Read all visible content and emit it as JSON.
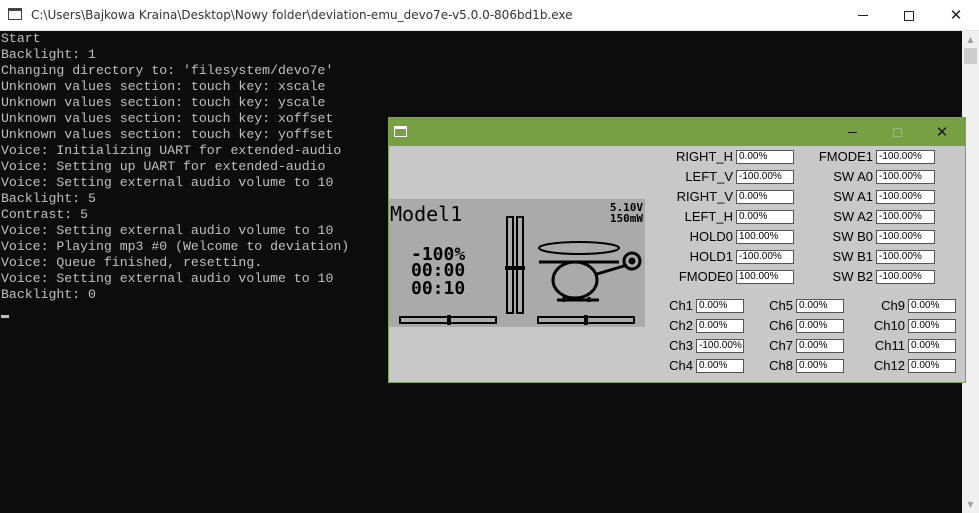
{
  "console_window": {
    "title": "C:\\Users\\Bajkowa Kraina\\Desktop\\Nowy folder\\deviation-emu_devo7e-v5.0.0-806bd1b.exe",
    "lines": [
      "Start",
      "Backlight: 1",
      "Changing directory to: 'filesystem/devo7e'",
      "Unknown values section: touch key: xscale",
      "Unknown values section: touch key: yscale",
      "Unknown values section: touch key: xoffset",
      "Unknown values section: touch key: yoffset",
      "Voice: Initializing UART for extended-audio",
      "Voice: Setting up UART for extended-audio",
      "Voice: Setting external audio volume to 10",
      "Backlight: 5",
      "Contrast: 5",
      "Voice: Setting external audio volume to 10",
      "Voice: Playing mp3 #0 (Welcome to deviation)",
      "Voice: Queue finished, resetting.",
      "Voice: Setting external audio volume to 10",
      "Backlight: 0"
    ],
    "controls": {
      "minimize": "minimize-icon",
      "maximize": "maximize-icon",
      "close": "✕"
    }
  },
  "emulator": {
    "title_bar_color": "#76a042",
    "close_glyph": "✕",
    "lcd": {
      "model_name": "Model1",
      "voltage": "5.10V",
      "power": "150mW",
      "throttle": "-100%",
      "timer1": "00:00",
      "timer2": "00:10"
    },
    "inputs_left": [
      {
        "label": "RIGHT_H",
        "value": "0.00%"
      },
      {
        "label": "LEFT_V",
        "value": "-100.00%"
      },
      {
        "label": "RIGHT_V",
        "value": "0.00%"
      },
      {
        "label": "LEFT_H",
        "value": "0.00%"
      },
      {
        "label": "HOLD0",
        "value": "100.00%"
      },
      {
        "label": "HOLD1",
        "value": "-100.00%"
      },
      {
        "label": "FMODE0",
        "value": "100.00%"
      }
    ],
    "inputs_right": [
      {
        "label": "FMODE1",
        "value": "-100.00%"
      },
      {
        "label": "SW A0",
        "value": "-100.00%"
      },
      {
        "label": "SW A1",
        "value": "-100.00%"
      },
      {
        "label": "SW A2",
        "value": "-100.00%"
      },
      {
        "label": "SW B0",
        "value": "-100.00%"
      },
      {
        "label": "SW B1",
        "value": "-100.00%"
      },
      {
        "label": "SW B2",
        "value": "-100.00%"
      }
    ],
    "channels": [
      {
        "label": "Ch1",
        "value": "0.00%"
      },
      {
        "label": "Ch2",
        "value": "0.00%"
      },
      {
        "label": "Ch3",
        "value": "-100.00%"
      },
      {
        "label": "Ch4",
        "value": "0.00%"
      },
      {
        "label": "Ch5",
        "value": "0.00%"
      },
      {
        "label": "Ch6",
        "value": "0.00%"
      },
      {
        "label": "Ch7",
        "value": "0.00%"
      },
      {
        "label": "Ch8",
        "value": "0.00%"
      },
      {
        "label": "Ch9",
        "value": "0.00%"
      },
      {
        "label": "Ch10",
        "value": "0.00%"
      },
      {
        "label": "Ch11",
        "value": "0.00%"
      },
      {
        "label": "Ch12",
        "value": "0.00%"
      }
    ]
  }
}
